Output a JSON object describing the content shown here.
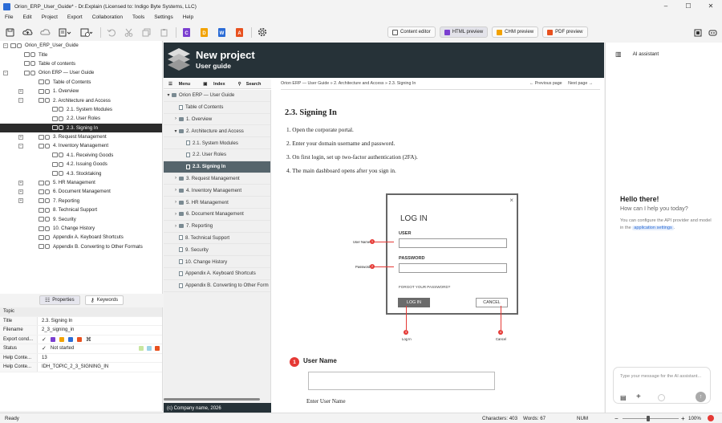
{
  "window": {
    "title": "Orion_ERP_User_Guide* - Dr.Explain (Licensed to: Indigo Byte Systems, LLC)"
  },
  "menu": [
    "File",
    "Edit",
    "Project",
    "Export",
    "Collaboration",
    "Tools",
    "Settings",
    "Help"
  ],
  "toolbar": {
    "doc_buttons": [
      "C",
      "D",
      "W",
      "A"
    ],
    "view_buttons": [
      "Content editor",
      "HTML preview",
      "CHM preview",
      "PDF preview"
    ],
    "active_view": "HTML preview"
  },
  "tree": {
    "items": [
      {
        "label": "Orion_ERP_User_Guide",
        "level": 0,
        "exp": "-"
      },
      {
        "label": "Title",
        "level": 1,
        "exp": ""
      },
      {
        "label": "Table of contents",
        "level": 1,
        "exp": ""
      },
      {
        "label": "Orion ERP — User Guide",
        "level": 1,
        "exp": "-"
      },
      {
        "label": "Table of Contents",
        "level": 2,
        "exp": ""
      },
      {
        "label": "1. Overview",
        "level": 2,
        "exp": "+"
      },
      {
        "label": "2. Architecture and Access",
        "level": 2,
        "exp": "-"
      },
      {
        "label": "2.1. System Modules",
        "level": 3,
        "exp": ""
      },
      {
        "label": "2.2. User Roles",
        "level": 3,
        "exp": ""
      },
      {
        "label": "2.3. Signing In",
        "level": 3,
        "exp": "",
        "selected": true
      },
      {
        "label": "3. Request Management",
        "level": 2,
        "exp": "+"
      },
      {
        "label": "4. Inventory Management",
        "level": 2,
        "exp": "-"
      },
      {
        "label": "4.1. Receiving Goods",
        "level": 3,
        "exp": ""
      },
      {
        "label": "4.2. Issuing Goods",
        "level": 3,
        "exp": ""
      },
      {
        "label": "4.3. Stocktaking",
        "level": 3,
        "exp": ""
      },
      {
        "label": "5. HR Management",
        "level": 2,
        "exp": "+"
      },
      {
        "label": "6. Document Management",
        "level": 2,
        "exp": "+"
      },
      {
        "label": "7. Reporting",
        "level": 2,
        "exp": "+"
      },
      {
        "label": "8. Technical Support",
        "level": 2,
        "exp": ""
      },
      {
        "label": "9. Security",
        "level": 2,
        "exp": ""
      },
      {
        "label": "10. Change History",
        "level": 2,
        "exp": ""
      },
      {
        "label": "Appendix A. Keyboard Shortcuts",
        "level": 2,
        "exp": ""
      },
      {
        "label": "Appendix B. Converting to Other Formats",
        "level": 2,
        "exp": ""
      }
    ]
  },
  "props_tabs": [
    "Properties",
    "Keywords"
  ],
  "props": {
    "header": "Topic",
    "rows": [
      {
        "k": "Title",
        "v": "2.3. Signing In"
      },
      {
        "k": "Filename",
        "v": "2_3_signing_in"
      },
      {
        "k": "Export cond...",
        "v": ""
      },
      {
        "k": "Status",
        "v": "Not started"
      },
      {
        "k": "Help Conte...",
        "v": "13"
      },
      {
        "k": "Help Conte...",
        "v": "IDH_TOPIC_2_3_SIGNING_IN"
      }
    ]
  },
  "status": {
    "left": "Ready",
    "characters": "Characters: 403",
    "words": "Words: 67",
    "num": "NUM",
    "zoom": "100%"
  },
  "preview": {
    "header_title": "New project",
    "header_sub": "User guide",
    "tabs": [
      "Menu",
      "Index",
      "Search"
    ],
    "toc": [
      {
        "label": "Orion ERP — User Guide",
        "level": 0,
        "type": "book",
        "car": "▾"
      },
      {
        "label": "Table of Contents",
        "level": 1,
        "type": "page",
        "car": ""
      },
      {
        "label": "1. Overview",
        "level": 1,
        "type": "book",
        "car": "›"
      },
      {
        "label": "2. Architecture and Access",
        "level": 1,
        "type": "book",
        "car": "▾"
      },
      {
        "label": "2.1. System Modules",
        "level": 2,
        "type": "page",
        "car": ""
      },
      {
        "label": "2.2. User Roles",
        "level": 2,
        "type": "page",
        "car": ""
      },
      {
        "label": "2.3. Signing In",
        "level": 2,
        "type": "page",
        "car": "",
        "selected": true
      },
      {
        "label": "3. Request Management",
        "level": 1,
        "type": "book",
        "car": "›"
      },
      {
        "label": "4. Inventory Management",
        "level": 1,
        "type": "book",
        "car": "›"
      },
      {
        "label": "5. HR Management",
        "level": 1,
        "type": "book",
        "car": "›"
      },
      {
        "label": "6. Document Management",
        "level": 1,
        "type": "book",
        "car": "›"
      },
      {
        "label": "7. Reporting",
        "level": 1,
        "type": "book",
        "car": "›"
      },
      {
        "label": "8. Technical Support",
        "level": 1,
        "type": "page",
        "car": ""
      },
      {
        "label": "9. Security",
        "level": 1,
        "type": "page",
        "car": ""
      },
      {
        "label": "10. Change History",
        "level": 1,
        "type": "page",
        "car": ""
      },
      {
        "label": "Appendix A. Keyboard Shortcuts",
        "level": 1,
        "type": "page",
        "car": ""
      },
      {
        "label": "Appendix B. Converting to Other Form",
        "level": 1,
        "type": "page",
        "car": ""
      }
    ],
    "footer": "(c) Company name, 2026",
    "breadcrumb": "Orion ERP — User Guide  »  2. Architecture and Access  »  2.3. Signing In",
    "prev": "← Previous page",
    "next": "Next page →",
    "topic_title": "2.3. Signing In",
    "steps": [
      "1. Open the corporate portal.",
      "2. Enter your domain username and password.",
      "3. On first login, set up two-factor authentication (2FA).",
      "4. The main dashboard opens after you sign in."
    ],
    "login": {
      "title": "LOG IN",
      "user_label": "USER",
      "password_label": "PASSWORD",
      "forgot": "FORGOT YOUR PASSWORD?",
      "login_btn": "LOG IN",
      "cancel_btn": "CANCEL",
      "callouts": [
        {
          "n": "1",
          "label": "User Name"
        },
        {
          "n": "2",
          "label": "Password"
        },
        {
          "n": "3",
          "label": "Log In"
        },
        {
          "n": "4",
          "label": "Cancel"
        }
      ]
    },
    "section_num": "1",
    "section_title": "User Name",
    "section_text": "Enter User Name"
  },
  "assistant": {
    "title": "AI assistant",
    "hello": "Hello there!",
    "help": "How can I help you today?",
    "config_text": "You can configure the API provider and model in the",
    "link": "application settings",
    "link_suffix": ".",
    "placeholder": "Type your message for the AI assistant..."
  }
}
